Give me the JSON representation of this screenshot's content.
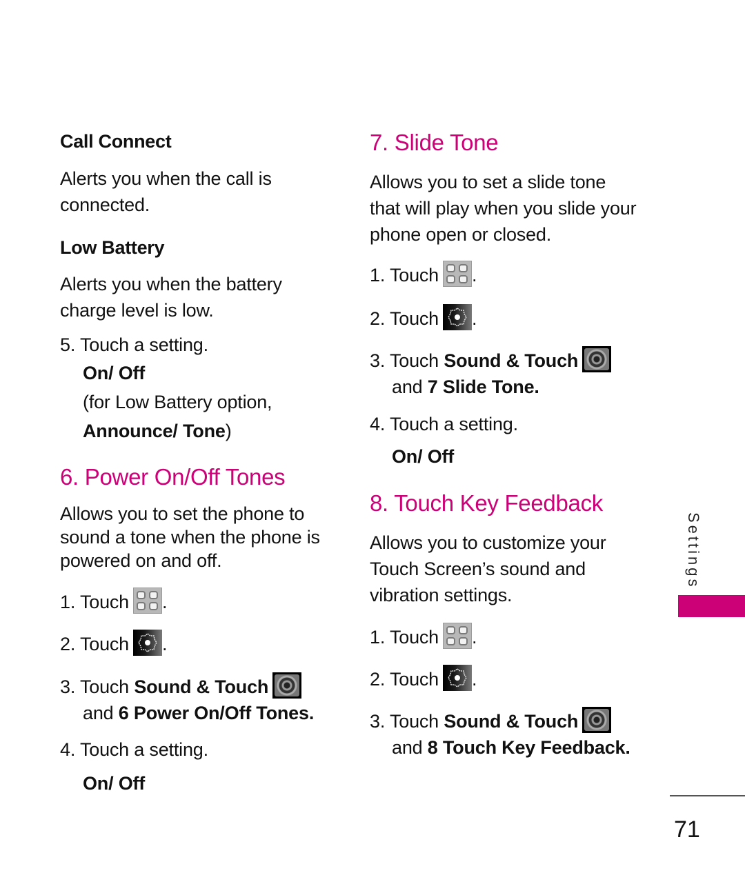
{
  "left": {
    "call_connect": {
      "title": "Call Connect",
      "desc_lines": [
        "Alerts you when the call is",
        "connected."
      ]
    },
    "low_battery": {
      "title": "Low Battery",
      "desc_lines": [
        "Alerts you when the battery",
        "charge level is low."
      ]
    },
    "step5": {
      "num": "5.",
      "text": "Touch a setting.",
      "option": "On/ Off",
      "note_line1": "(for Low Battery option,",
      "note_bold": "Announce/ Tone",
      "note_close": ")"
    },
    "section6": {
      "heading": "6. Power On/Off Tones",
      "desc_lines": [
        "Allows you to set the phone to",
        "sound a tone when the phone is",
        "powered on and off."
      ],
      "steps": [
        {
          "num": "1.",
          "text": "Touch",
          "icon": "menu-grid-icon",
          "after": "."
        },
        {
          "num": "2.",
          "text": "Touch",
          "icon": "settings-gear-icon",
          "after": "."
        },
        {
          "num": "3.",
          "text": "Touch",
          "bold": "Sound & Touch",
          "icon": "speaker-icon",
          "line2_pre": "and",
          "line2_bold": "6 Power On/Off Tones",
          "after": "."
        },
        {
          "num": "4.",
          "text": "Touch a setting.",
          "option": "On/ Off"
        }
      ]
    }
  },
  "right": {
    "section7": {
      "heading": "7. Slide Tone",
      "desc_lines": [
        "Allows you to set a slide tone",
        "that will play when you slide your",
        "phone open or closed."
      ],
      "steps": [
        {
          "num": "1.",
          "text": "Touch",
          "icon": "menu-grid-icon",
          "after": "."
        },
        {
          "num": "2.",
          "text": "Touch",
          "icon": "settings-gear-icon",
          "after": "."
        },
        {
          "num": "3.",
          "text": "Touch",
          "bold": "Sound & Touch",
          "icon": "speaker-icon",
          "line2_pre": "and",
          "line2_bold": "7 Slide Tone",
          "after": "."
        },
        {
          "num": "4.",
          "text": "Touch a setting.",
          "option": "On/ Off"
        }
      ]
    },
    "section8": {
      "heading": "8. Touch Key Feedback",
      "desc_lines": [
        "Allows you to customize your",
        "Touch Screen’s sound and",
        "vibration settings."
      ],
      "steps": [
        {
          "num": "1.",
          "text": "Touch",
          "icon": "menu-grid-icon",
          "after": "."
        },
        {
          "num": "2.",
          "text": "Touch",
          "icon": "settings-gear-icon",
          "after": "."
        },
        {
          "num": "3.",
          "text": "Touch",
          "bold": "Sound & Touch",
          "icon": "speaker-icon",
          "line2_pre": "and",
          "line2_bold": "8 Touch Key Feedback",
          "after": "."
        }
      ]
    }
  },
  "side_tab": {
    "label": "Settings",
    "color": "#cc0077"
  },
  "page_number": "71",
  "accent_color": "#cc0077"
}
